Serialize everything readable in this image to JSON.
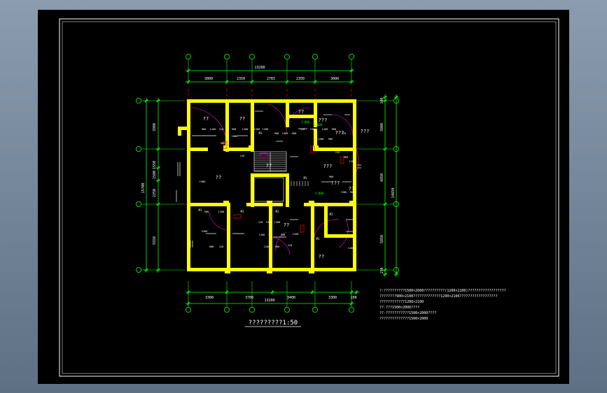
{
  "drawing": {
    "plan_title": "?????????1:50",
    "top_dims": {
      "overall": "13200",
      "segments": [
        "3000",
        "2350",
        "2765",
        "2350",
        "3000"
      ]
    },
    "bottom_dims": {
      "overall": "13200",
      "segments": [
        "3300",
        "3700",
        "3400",
        "3300",
        "100"
      ]
    },
    "left_dims": {
      "overall": "15700",
      "segments": [
        "3900",
        "1550",
        "1500",
        "2250",
        "5550"
      ]
    },
    "right_dims": {
      "overall": "14850",
      "segments": [
        "100",
        "3900",
        "4850",
        "5850",
        "150"
      ]
    },
    "room_labels": [
      "??",
      "??",
      "??",
      "???",
      "???",
      "???",
      "???",
      "???",
      "??",
      "??",
      "??",
      "??",
      "??"
    ],
    "room_marks": [
      "M1",
      "M1",
      "M1",
      "M1",
      "M1",
      "M1",
      "M1",
      "M1"
    ],
    "elev_marks": [
      "3.000",
      "3.000",
      "3.000"
    ],
    "small_dims": [
      "900",
      "1200",
      "120",
      "900",
      "1200",
      "1500",
      "1200",
      "900",
      "1500",
      "900",
      "120",
      "1500",
      "1200",
      "900",
      "120",
      "900",
      "1080",
      "120",
      "1200",
      "900",
      "120",
      "900",
      "1200",
      "900",
      "1500",
      "900",
      "1900",
      "900",
      "1200",
      "120",
      "1500",
      "1200",
      "1200",
      "900",
      "1200",
      "3300",
      "900",
      "120",
      "1200",
      "900",
      "120",
      "1200"
    ],
    "notes": [
      "?·??????????1500×2000??????????(1200×2100)??????????????????",
      "  ????????900×2100?????????????1200×2100??????????????????",
      "  ????????????1200×2100",
      "  ??·???1500×2000????",
      "  ??·???????????1500×2000????",
      "  ??????????????1500×2000"
    ],
    "colors": {
      "background": "#000000",
      "wall": "#ffff00",
      "dimension": "#00ff00",
      "axis_red": "#ff0000",
      "door_swing": "#ff00ff",
      "text": "#ffffff"
    }
  }
}
